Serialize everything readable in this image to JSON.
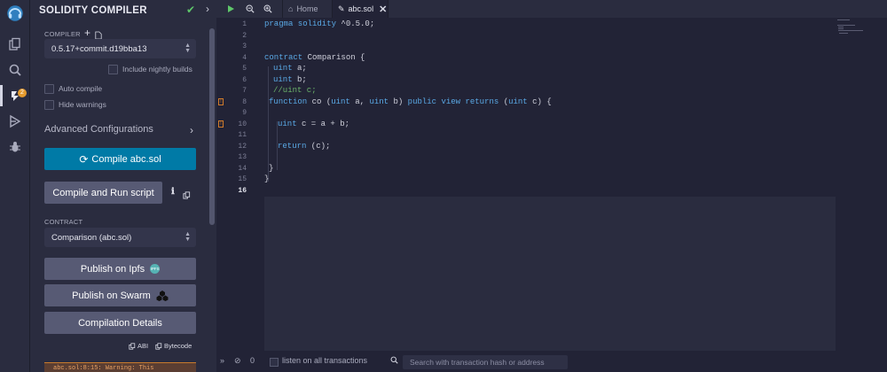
{
  "panel": {
    "title": "SOLIDITY COMPILER",
    "compiler_label": "COMPILER",
    "compiler_version": "0.5.17+commit.d19bba13",
    "nightly_label": "Include nightly builds",
    "auto_compile_label": "Auto compile",
    "hide_warnings_label": "Hide warnings",
    "advanced_label": "Advanced Configurations",
    "compile_button": "Compile abc.sol",
    "run_script_button": "Compile and Run script",
    "contract_label": "CONTRACT",
    "contract_value": "Comparison (abc.sol)",
    "ipfs_button": "Publish on Ipfs",
    "ipfs_badge": "IPFS",
    "swarm_button": "Publish on Swarm",
    "details_button": "Compilation Details",
    "abi_label": "ABI",
    "bytecode_label": "Bytecode",
    "warning_text": "abc.sol:8:15: Warning: This"
  },
  "rail": {
    "badge_count": "2"
  },
  "editor": {
    "tabs": [
      {
        "label": "Home",
        "icon": "home-icon"
      },
      {
        "label": "abc.sol",
        "icon": "file-icon"
      }
    ],
    "line_numbers": [
      "1",
      "2",
      "3",
      "4",
      "5",
      "6",
      "7",
      "8",
      "9",
      "10",
      "11",
      "12",
      "13",
      "14",
      "15",
      "16"
    ],
    "current_line": "16",
    "code": {
      "l1a": "pragma solidity",
      "l1b": " ^0.5.0;",
      "l4a": "contract",
      "l4b": " Comparison {",
      "l5a": "uint",
      "l5b": " a;",
      "l6a": "uint",
      "l6b": " b;",
      "l7": "//uint c;",
      "l8a": "function",
      "l8b": " co (",
      "l8c": "uint",
      "l8d": " a, ",
      "l8e": "uint",
      "l8f": " b) ",
      "l8g": "public view returns",
      "l8h": " (",
      "l8i": "uint",
      "l8j": " c) {",
      "l10a": "uint",
      "l10b": " c = a + b;",
      "l12a": "return",
      "l12b": " (c);",
      "l14": "}",
      "l15": "}"
    }
  },
  "terminal": {
    "count": "0",
    "listen_label": "listen on all transactions",
    "search_placeholder": "Search with transaction hash or address"
  },
  "colors": {
    "accent": "#007aa6",
    "success": "#5ec76a",
    "warning": "#e59b2e"
  }
}
